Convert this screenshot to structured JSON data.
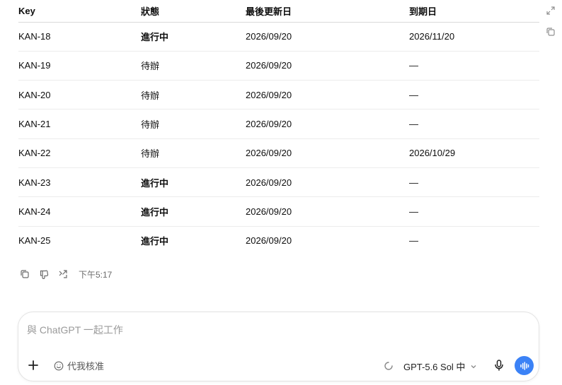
{
  "table": {
    "headers": [
      "Key",
      "狀態",
      "最後更新日",
      "到期日"
    ],
    "rows": [
      {
        "key": "KAN-18",
        "status": "進行中",
        "updated": "2026/09/20",
        "due": "2026/11/20",
        "todo": false
      },
      {
        "key": "KAN-19",
        "status": "待辦",
        "updated": "2026/09/20",
        "due": "—",
        "todo": true
      },
      {
        "key": "KAN-20",
        "status": "待辦",
        "updated": "2026/09/20",
        "due": "—",
        "todo": true
      },
      {
        "key": "KAN-21",
        "status": "待辦",
        "updated": "2026/09/20",
        "due": "—",
        "todo": true
      },
      {
        "key": "KAN-22",
        "status": "待辦",
        "updated": "2026/09/20",
        "due": "2026/10/29",
        "todo": true
      },
      {
        "key": "KAN-23",
        "status": "進行中",
        "updated": "2026/09/20",
        "due": "—",
        "todo": false
      },
      {
        "key": "KAN-24",
        "status": "進行中",
        "updated": "2026/09/20",
        "due": "—",
        "todo": false
      },
      {
        "key": "KAN-25",
        "status": "進行中",
        "updated": "2026/09/20",
        "due": "—",
        "todo": false
      }
    ]
  },
  "corner_icons": [
    "expand-icon",
    "copy-table-icon"
  ],
  "message_actions": {
    "icons": [
      "copy-icon",
      "dislike-icon",
      "share-icon"
    ],
    "time": "下午5:17"
  },
  "composer": {
    "placeholder": "與 ChatGPT 一起工作",
    "approve_label": "代我核准",
    "model_label": "GPT-5.6 Sol 中",
    "voice_color": "#3b82f6"
  }
}
